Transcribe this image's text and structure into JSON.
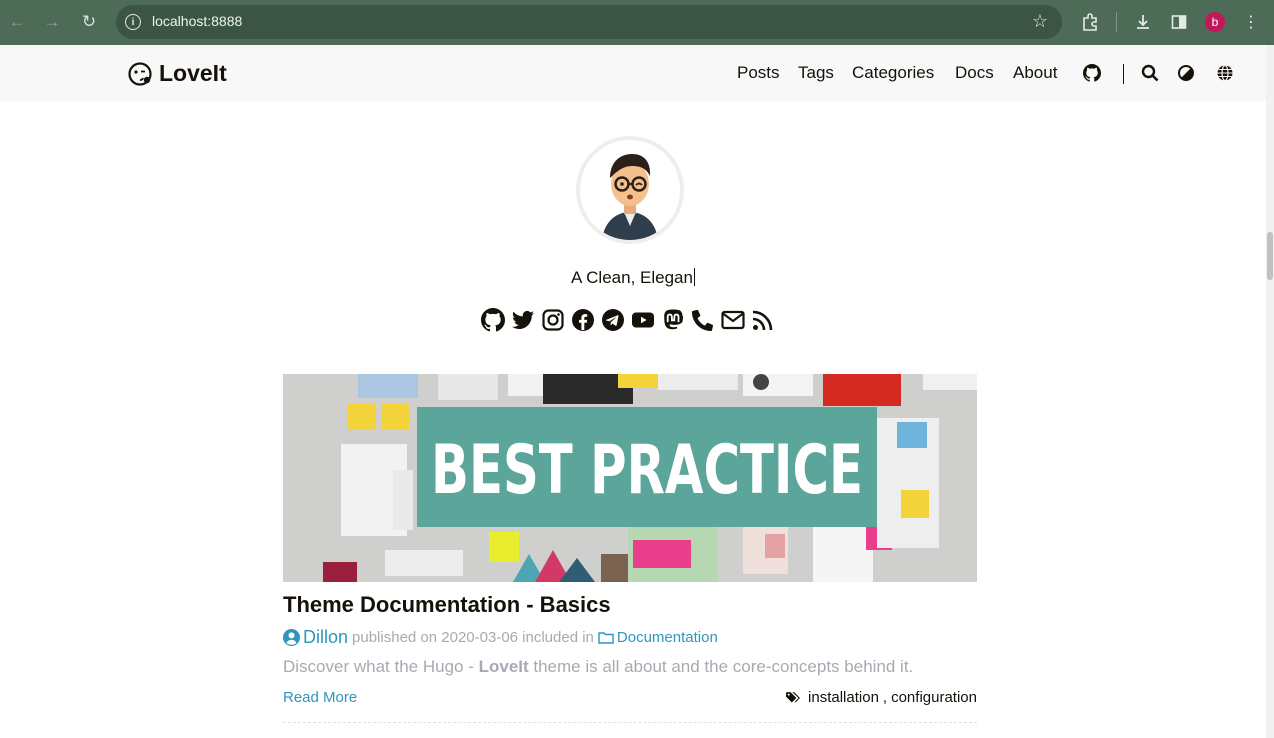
{
  "browser": {
    "url": "localhost:8888",
    "profile_initial": "b"
  },
  "site": {
    "logo_text": "LoveIt",
    "menu": [
      "Posts",
      "Tags",
      "Categories",
      "Docs",
      "About"
    ],
    "menu_icons": [
      "github-icon",
      "search-icon",
      "theme-switch-icon",
      "language-icon"
    ]
  },
  "profile": {
    "subtitle": "A Clean, Elegan",
    "social_icons": [
      "github-icon",
      "twitter-icon",
      "instagram-icon",
      "facebook-icon",
      "telegram-icon",
      "youtube-icon",
      "mastodon-icon",
      "phone-icon",
      "email-icon",
      "rss-icon"
    ]
  },
  "post": {
    "featured_image_text": "BEST PRACTICE",
    "title": "Theme Documentation - Basics",
    "author": "Dillon",
    "published_label": "published on 2020-03-06 included in",
    "category": "Documentation",
    "summary_prefix": "Discover what the Hugo - ",
    "summary_bold": "LoveIt",
    "summary_suffix": " theme is all about and the core-concepts behind it.",
    "read_more": "Read More",
    "tag_1": "installation",
    "tag_sep": ", ",
    "tag_2": "configuration"
  },
  "colors": {
    "chrome_bg": "#4d6b57",
    "link": "#2d96bd",
    "muted": "#a9a9b3",
    "banner": "#5ba59a"
  }
}
